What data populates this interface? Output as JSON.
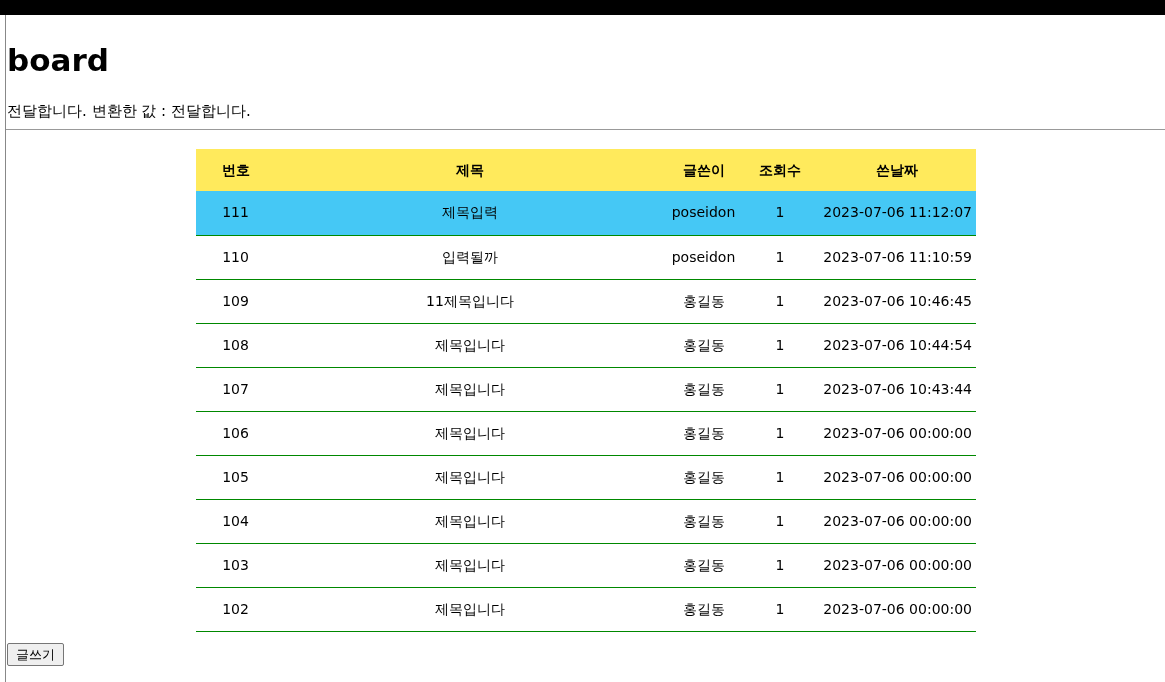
{
  "heading": "board",
  "message": "전달합니다. 변환한 값 : 전달합니다.",
  "table": {
    "columns": [
      "번호",
      "제목",
      "글쓴이",
      "조회수",
      "쓴날짜"
    ],
    "rows": [
      {
        "cells": [
          "111",
          "제목입력",
          "poseidon",
          "1",
          "2023-07-06 11:12:07"
        ],
        "selected": true
      },
      {
        "cells": [
          "110",
          "입력될까",
          "poseidon",
          "1",
          "2023-07-06 11:10:59"
        ],
        "selected": false
      },
      {
        "cells": [
          "109",
          "11제목입니다",
          "홍길동",
          "1",
          "2023-07-06 10:46:45"
        ],
        "selected": false
      },
      {
        "cells": [
          "108",
          "제목입니다",
          "홍길동",
          "1",
          "2023-07-06 10:44:54"
        ],
        "selected": false
      },
      {
        "cells": [
          "107",
          "제목입니다",
          "홍길동",
          "1",
          "2023-07-06 10:43:44"
        ],
        "selected": false
      },
      {
        "cells": [
          "106",
          "제목입니다",
          "홍길동",
          "1",
          "2023-07-06 00:00:00"
        ],
        "selected": false
      },
      {
        "cells": [
          "105",
          "제목입니다",
          "홍길동",
          "1",
          "2023-07-06 00:00:00"
        ],
        "selected": false
      },
      {
        "cells": [
          "104",
          "제목입니다",
          "홍길동",
          "1",
          "2023-07-06 00:00:00"
        ],
        "selected": false
      },
      {
        "cells": [
          "103",
          "제목입니다",
          "홍길동",
          "1",
          "2023-07-06 00:00:00"
        ],
        "selected": false
      },
      {
        "cells": [
          "102",
          "제목입니다",
          "홍길동",
          "1",
          "2023-07-06 00:00:00"
        ],
        "selected": false
      }
    ]
  },
  "write_button": "글쓰기"
}
